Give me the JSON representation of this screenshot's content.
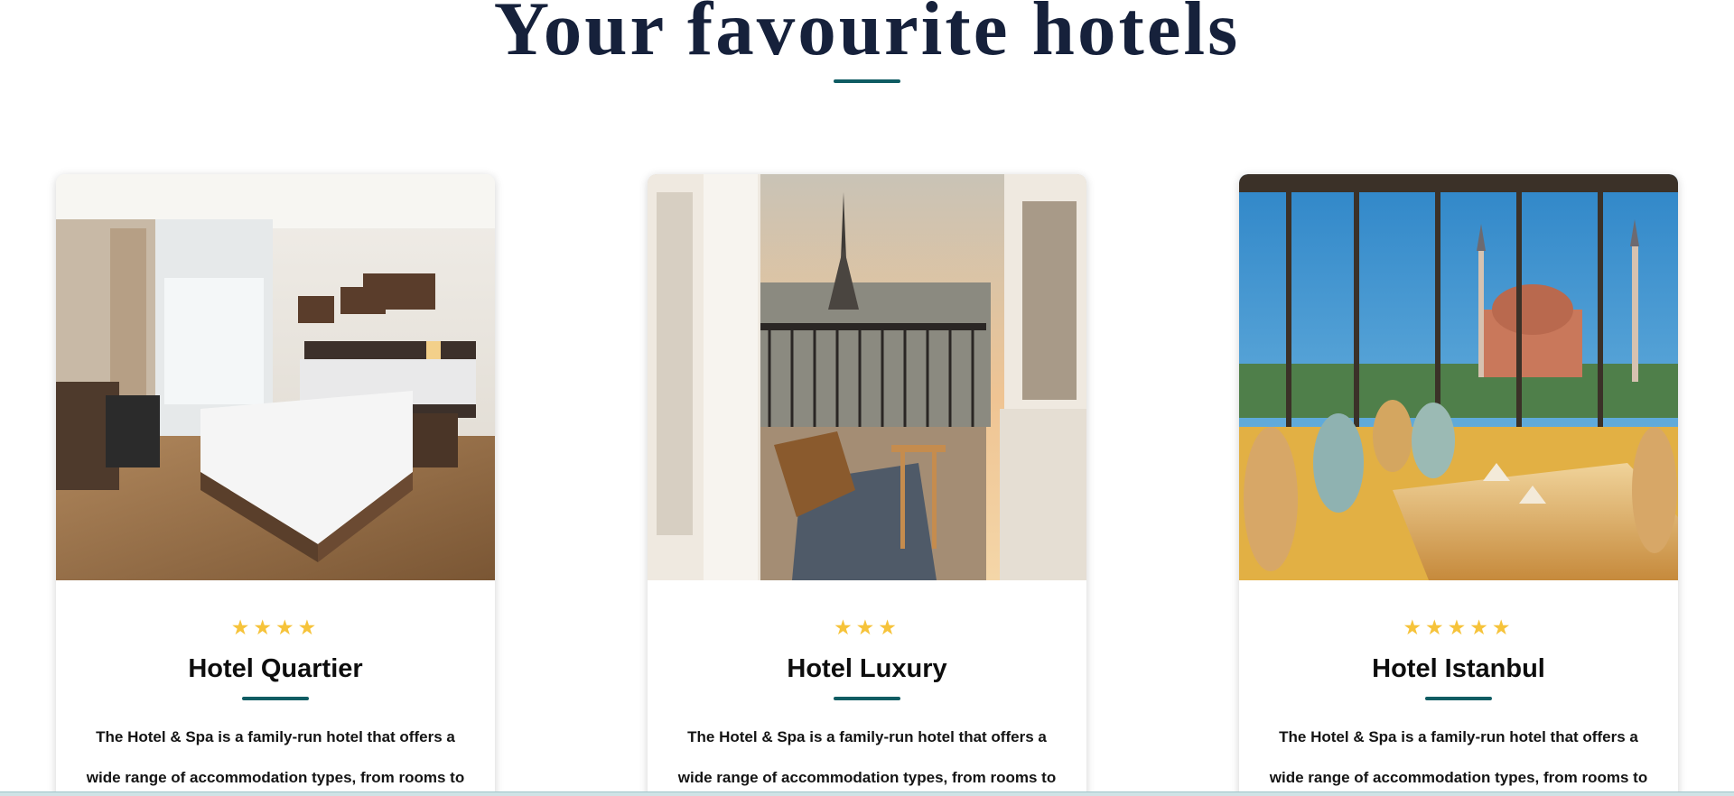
{
  "section": {
    "title": "Your favourite hotels"
  },
  "hotels": [
    {
      "name": "Hotel Quartier",
      "stars": "★★★★",
      "rating": 4,
      "description": "The Hotel & Spa is a family-run hotel that offers a wide range of accommodation types, from rooms to",
      "image": "hotel-room-photo"
    },
    {
      "name": "Hotel Luxury",
      "stars": "★★★",
      "rating": 3,
      "description": "The Hotel & Spa is a family-run hotel that offers a wide range of accommodation types, from rooms to",
      "image": "paris-balcony-photo"
    },
    {
      "name": "Hotel Istanbul",
      "stars": "★★★★★",
      "rating": 5,
      "description": "The Hotel & Spa is a family-run hotel that offers a wide range of accommodation types, from rooms to",
      "image": "istanbul-restaurant-photo"
    }
  ],
  "colors": {
    "title": "#16213b",
    "accent": "#0f5c63",
    "star": "#f6c33a"
  }
}
